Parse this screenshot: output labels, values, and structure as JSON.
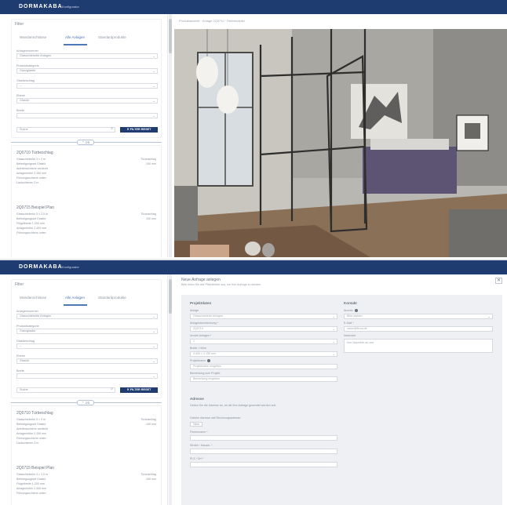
{
  "brand": {
    "logo": "DORMAKABA",
    "tagline": "Konfigurator"
  },
  "filter": {
    "title": "Filter",
    "tabs": [
      "Wandanschlüsse",
      "Alle Anlagen",
      "Standardprodukte"
    ],
    "active_tab": 1,
    "fields": [
      {
        "label": "Anlagennummer",
        "value": "Glasschiebetür Anlagen"
      },
      {
        "label": "Produktkategorie",
        "value": "Ganzglastür"
      },
      {
        "label": "Glasbeschlag",
        "value": "--"
      },
      {
        "label": "Ebene",
        "value": "Glastür"
      },
      {
        "label": "Breite",
        "value": ""
      }
    ],
    "search": {
      "placeholder": "Suche",
      "icon": "search-icon"
    },
    "reset_label": "✕ FILTER RESET",
    "divider_label": "⌃ 2/5"
  },
  "results": [
    {
      "title": "2Q0710 Türbeschlag",
      "rows": [
        {
          "k": "Glasschiebetür 3 × 2 m",
          "v": "Türanschlag"
        },
        {
          "k": "Befestigungsart Glastür",
          "v": "100 mm"
        },
        {
          "k": "Antriebsschiene verdeckt",
          "v": ""
        },
        {
          "k": "Anlagenhöhe 2.150 mm",
          "v": ""
        },
        {
          "k": "Führungsschiene unten",
          "v": ""
        },
        {
          "k": "Laufschienen 3 m",
          "v": ""
        }
      ]
    },
    {
      "title": "2Q0715 Beispiel Plan",
      "rows": [
        {
          "k": "Glasschiebetür 3 × 2,5 m",
          "v": "Türanschlag"
        },
        {
          "k": "Befestigungsart Glastür",
          "v": "100 mm"
        },
        {
          "k": "Flügelbreite 1.200 mm",
          "v": ""
        },
        {
          "k": "Anlagenhöhe 2.400 mm",
          "v": ""
        },
        {
          "k": "Führungsschiene unten",
          "v": ""
        }
      ]
    }
  ],
  "viewer": {
    "breadcrumb": "Produktansicht · Anlage 2Q0710 · Referenzbild"
  },
  "form": {
    "heading": "Neue Anfrage anlegen",
    "subheading": "Bitte füllen Sie alle Pflichtfelder aus, um Ihre Anfrage zu senden.",
    "close": "✕",
    "left_title": "Projektdaten",
    "right_title": "Kontakt",
    "left_fields": [
      {
        "label": "Anlage",
        "value": "Glasschiebetür Anlagen",
        "select": true
      },
      {
        "label": "Anlagenbezeichnung *",
        "value": "2Q0710",
        "select": true
      },
      {
        "label": "Anzahl Anlagen *",
        "value": "1",
        "select": true
      },
      {
        "label": "Breite / Höhe",
        "value": "3.000 × 2.150 mm",
        "select": true
      },
      {
        "label": "Projektname",
        "value": "Projektname eingeben",
        "select": false
      },
      {
        "label": "Bemerkung zum Projekt",
        "value": "Bemerkung eingeben",
        "select": false
      }
    ],
    "address_title": "Adresse",
    "address_text": "Geben Sie die Adresse an, an die Ihre Anfrage gesendet werden soll.",
    "checkbox_label": "Gleiche Adresse wie Rechnungsadresse",
    "checkbox_value": "Nein",
    "address_fields": [
      "Firmenname *",
      "Straße / Hausnr. *",
      "PLZ / Ort *"
    ],
    "right_fields": [
      {
        "label": "Anrede",
        "value": "Bitte wählen",
        "select": true
      },
      {
        "label": "E-Mail *",
        "value": "name@firma.de",
        "select": false
      }
    ],
    "right_note_label": "Nachricht",
    "right_note_placeholder": "Ihre Nachricht an uns"
  }
}
